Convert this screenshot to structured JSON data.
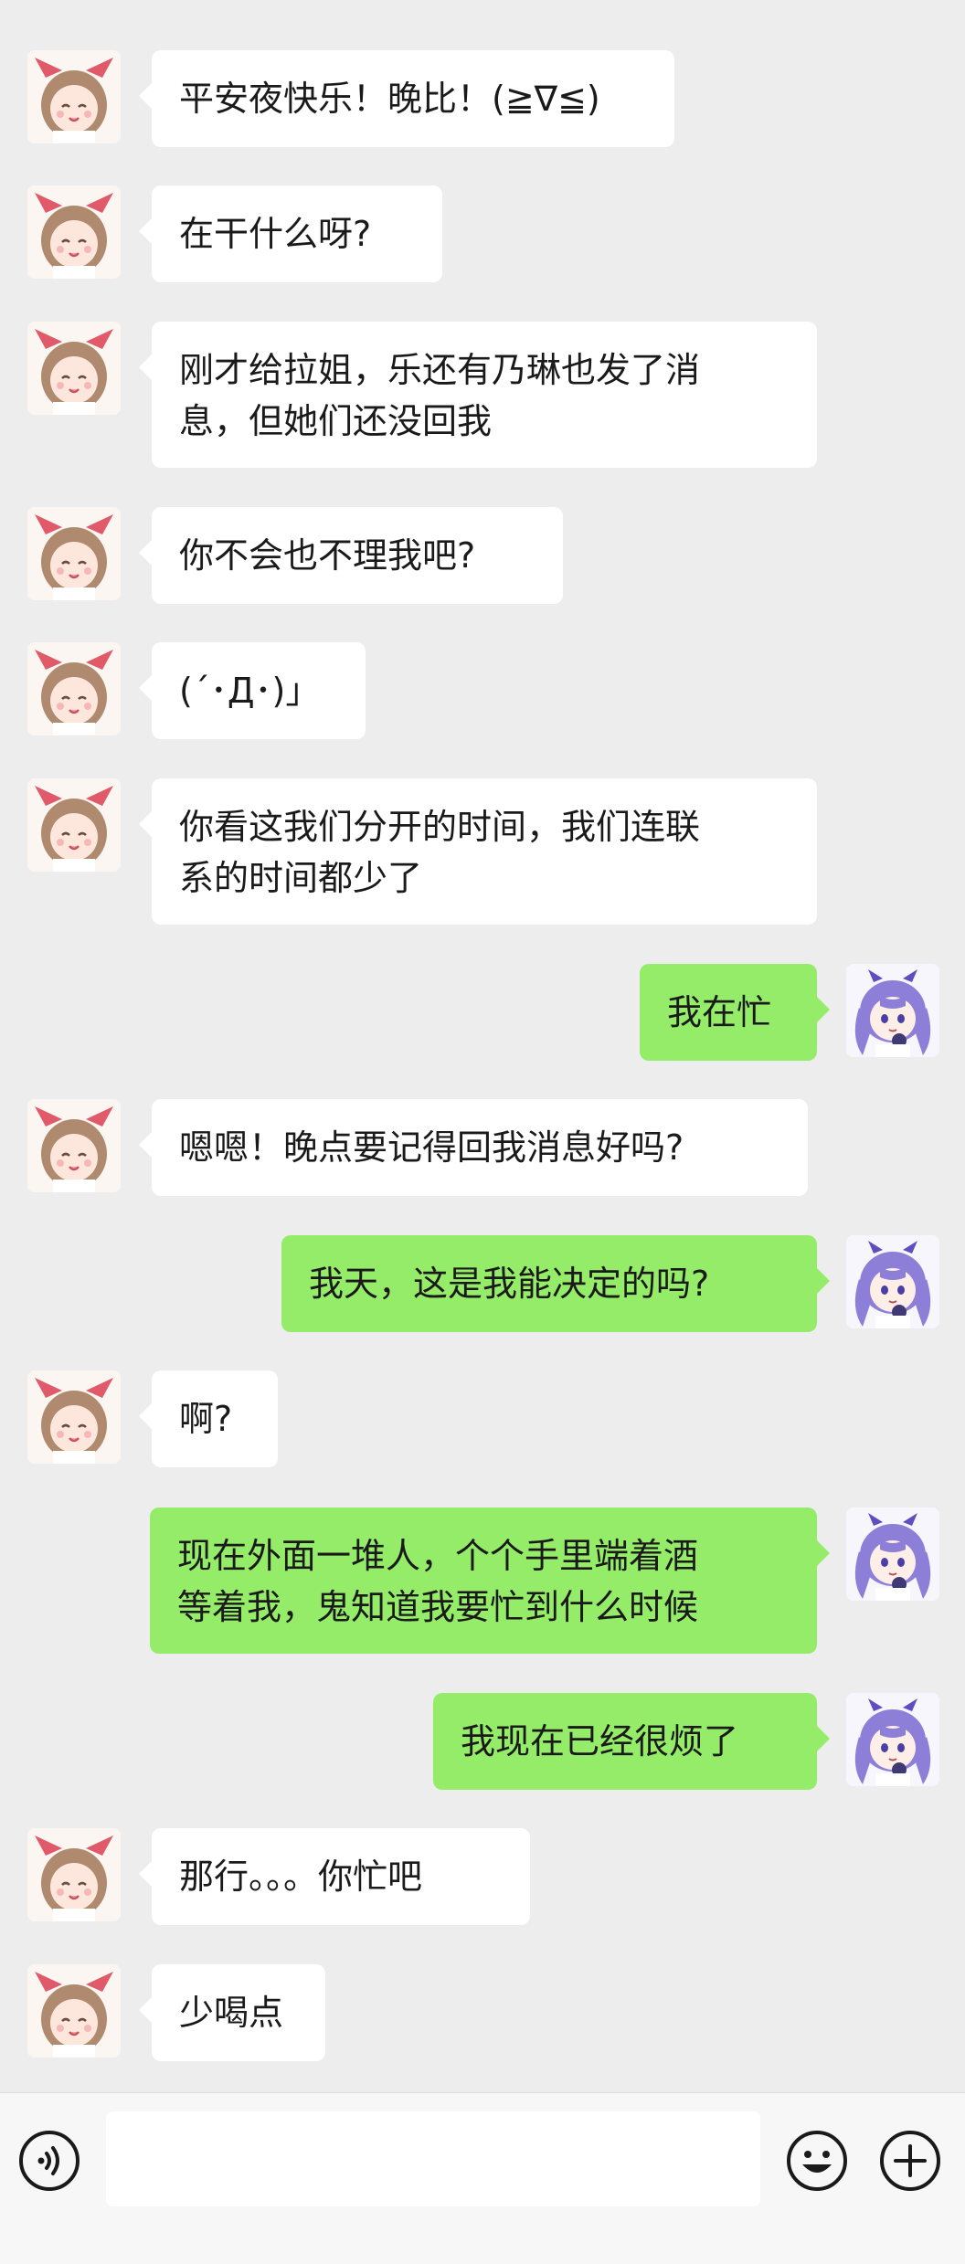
{
  "messages": [
    {
      "side": "left",
      "text": "平安夜快乐！晚比！(≧∇≦)"
    },
    {
      "side": "left",
      "text": "在干什么呀?"
    },
    {
      "side": "left",
      "text": "刚才给拉姐，乐还有乃琳也发了消\n息，但她们还没回我"
    },
    {
      "side": "left",
      "text": "你不会也不理我吧?"
    },
    {
      "side": "left",
      "text": "(´･Д･)」"
    },
    {
      "side": "left",
      "text": "你看这我们分开的时间，我们连联\n系的时间都少了"
    },
    {
      "side": "right",
      "text": "我在忙"
    },
    {
      "side": "left",
      "text": "嗯嗯！晚点要记得回我消息好吗?"
    },
    {
      "side": "right",
      "text": "我天，这是我能决定的吗?"
    },
    {
      "side": "left",
      "text": "啊?"
    },
    {
      "side": "right",
      "text": "现在外面一堆人，个个手里端着酒\n等着我，鬼知道我要忙到什么时候"
    },
    {
      "side": "right",
      "text": "我现在已经很烦了"
    },
    {
      "side": "left",
      "text": "那行。。。你忙吧"
    },
    {
      "side": "left",
      "text": "少喝点"
    }
  ],
  "avatars": {
    "left": {
      "icon": "anime-girl-bow-avatar",
      "hair": "#b08a6e",
      "bow": "#e05a6a"
    },
    "right": {
      "icon": "anime-girl-purple-avatar",
      "hair": "#8d7fd8",
      "accent": "#5d4fc0"
    }
  },
  "input_bar": {
    "placeholder": "",
    "voice_icon": "voice-icon",
    "emoji_icon": "emoji-icon",
    "plus_icon": "plus-icon"
  },
  "colors": {
    "background": "#ededed",
    "incoming_bubble": "#ffffff",
    "outgoing_bubble": "#95ec69"
  }
}
